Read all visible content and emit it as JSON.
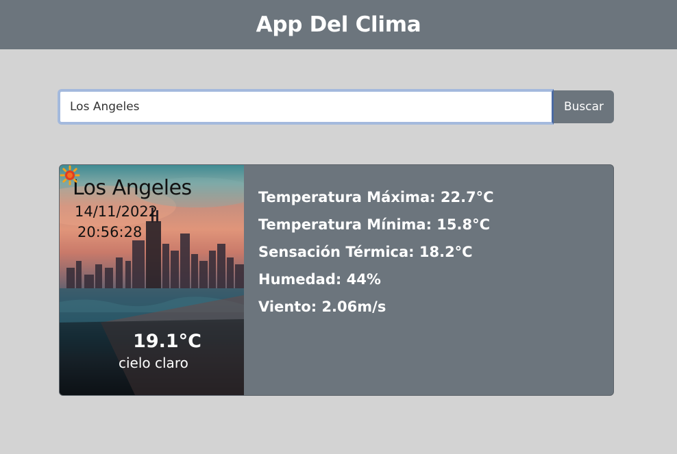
{
  "navbar": {
    "title": "App Del Clima"
  },
  "search": {
    "value": "Los Angeles",
    "button_label": "Buscar"
  },
  "weather": {
    "city": "Los Angeles",
    "date": "14/11/2022",
    "time": "20:56:28",
    "temperature": "19.1°C",
    "condition": "cielo claro",
    "condition_icon": "sun-icon",
    "details": [
      "Temperatura Máxima: 22.7°C",
      "Temperatura Mínima: 15.8°C",
      "Sensación Térmica: 18.2°C",
      "Humedad: 44%",
      "Viento: 2.06m/s"
    ]
  },
  "colors": {
    "navbar": "#6c757d",
    "background": "#d3d3d3",
    "card": "#6c757d",
    "text_on_dark": "#ffffff"
  }
}
